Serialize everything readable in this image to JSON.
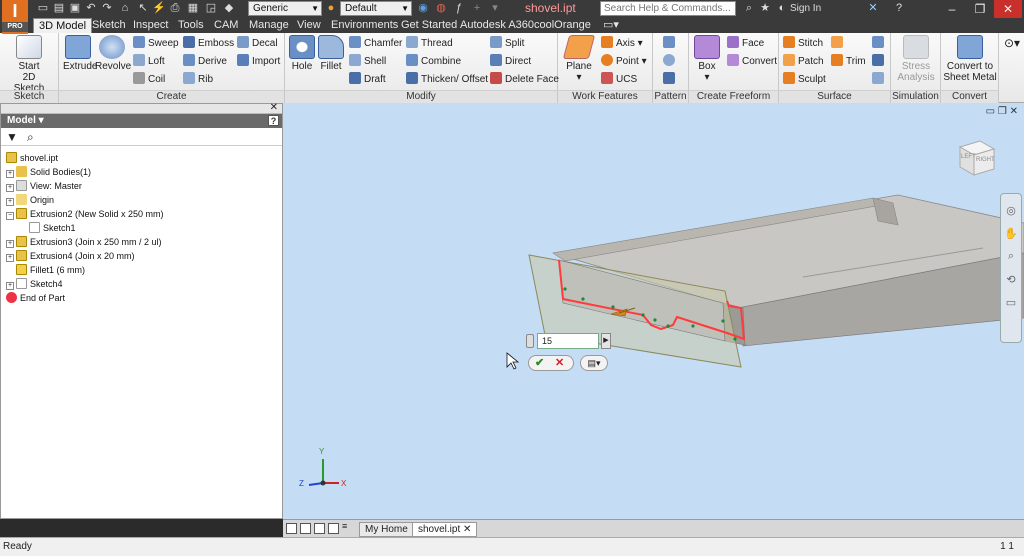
{
  "titlebar": {
    "app_logo": "I",
    "app_edition": "PRO",
    "material_combo": "Generic",
    "appearance_combo": "Default",
    "document_title": "shovel.ipt",
    "search_placeholder": "Search Help & Commands...",
    "sign_in": "Sign In"
  },
  "tabs": [
    "3D Model",
    "Sketch",
    "Inspect",
    "Tools",
    "CAM",
    "Manage",
    "View",
    "Environments",
    "Get Started",
    "Autodesk A360",
    "coolOrange"
  ],
  "ribbon": {
    "sketch": {
      "label": "Sketch",
      "start_line1": "Start",
      "start_line2": "2D Sketch"
    },
    "create": {
      "label": "Create",
      "extrude": "Extrude",
      "revolve": "Revolve",
      "sweep": "Sweep",
      "loft": "Loft",
      "coil": "Coil",
      "emboss": "Emboss",
      "derive": "Derive",
      "rib": "Rib",
      "decal": "Decal",
      "import": "Import"
    },
    "modify": {
      "label": "Modify",
      "hole": "Hole",
      "fillet": "Fillet",
      "chamfer": "Chamfer",
      "shell": "Shell",
      "draft": "Draft",
      "thread": "Thread",
      "combine": "Combine",
      "thicken": "Thicken/ Offset",
      "split": "Split",
      "direct": "Direct",
      "delete_face": "Delete Face"
    },
    "work_features": {
      "label": "Work Features",
      "plane": "Plane",
      "axis": "Axis",
      "point": "Point",
      "ucs": "UCS"
    },
    "pattern": {
      "label": "Pattern"
    },
    "freeform": {
      "label": "Create Freeform",
      "box": "Box",
      "face": "Face",
      "convert": "Convert"
    },
    "surface": {
      "label": "Surface",
      "stitch": "Stitch",
      "patch": "Patch",
      "sculpt": "Sculpt",
      "trim": "Trim"
    },
    "simulation": {
      "label": "Simulation",
      "stress_line1": "Stress",
      "stress_line2": "Analysis"
    },
    "convert": {
      "label": "Convert",
      "sheet_line1": "Convert to",
      "sheet_line2": "Sheet Metal"
    }
  },
  "browser": {
    "title": "Model",
    "items": [
      {
        "label": "shovel.ipt"
      },
      {
        "label": "Solid Bodies(1)"
      },
      {
        "label": "View: Master"
      },
      {
        "label": "Origin"
      },
      {
        "label": "Extrusion2 (New Solid x 250 mm)"
      },
      {
        "label": "Sketch1"
      },
      {
        "label": "Extrusion3 (Join x 250 mm / 2 ul)"
      },
      {
        "label": "Extrusion4 (Join x 20 mm)"
      },
      {
        "label": "Fillet1 (6 mm)"
      },
      {
        "label": "Sketch4"
      },
      {
        "label": "End of Part"
      }
    ]
  },
  "viewport": {
    "viewcube_label": "RIGHT",
    "viewcube_label2": "LEFT",
    "dimension_value": "15",
    "axis_x": "X",
    "axis_y": "Y",
    "axis_z": "Z"
  },
  "doc_tabs": {
    "home": "My Home",
    "file": "shovel.ipt"
  },
  "status": {
    "text": "Ready",
    "right": "1  1"
  },
  "colors": {
    "accent": "#e0701f",
    "viewport": "#c5dcf5",
    "highlight": "#ff3b3b"
  }
}
